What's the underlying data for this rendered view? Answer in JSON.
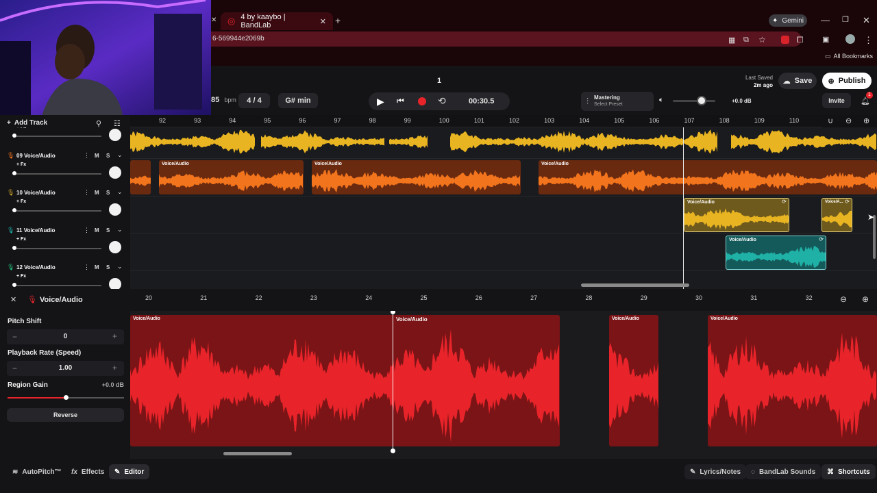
{
  "browser": {
    "tab_title": "4 by kaaybo | BandLab",
    "url_fragment": "6-569944e2069b",
    "gemini_label": "Gemini",
    "bookmarks_label": "All Bookmarks"
  },
  "project": {
    "title_number": "1",
    "last_saved_label": "Last Saved",
    "last_saved_value": "2m ago",
    "save_label": "Save",
    "publish_label": "Publish",
    "invite_label": "Invite",
    "notification_count": "1"
  },
  "transport": {
    "bpm_value": "85",
    "bpm_unit": "bpm",
    "time_signature": "4 / 4",
    "key": "G# min",
    "time": "00:30.5",
    "mastering_title": "Mastering",
    "mastering_preset": "Select Preset",
    "master_volume_db": "+0.0 dB"
  },
  "timeline": {
    "add_track_label": "Add Track",
    "ruler_ticks": [
      "92",
      "93",
      "94",
      "95",
      "96",
      "97",
      "98",
      "99",
      "100",
      "101",
      "102",
      "103",
      "104",
      "105",
      "106",
      "107",
      "108",
      "109",
      "110"
    ],
    "tracks": [
      {
        "number": "",
        "name": "",
        "fx": "+ Fx",
        "color": "#e8b422"
      },
      {
        "number": "09",
        "name": "Voice/Audio",
        "fx": "+ Fx",
        "color": "#f2741c"
      },
      {
        "number": "10",
        "name": "Voice/Audio",
        "fx": "+ Fx",
        "color": "#c8a22a"
      },
      {
        "number": "11",
        "name": "Voice/Audio",
        "fx": "+ Fx",
        "color": "#1fb0a6"
      },
      {
        "number": "12",
        "name": "Voice/Audio",
        "fx": "+ Fx",
        "color": "#22c07a"
      }
    ],
    "clip_label": "Voice/Audio",
    "clip_label_short": "Voice/A...",
    "mute_label": "M",
    "solo_label": "S"
  },
  "editor": {
    "title": "Voice/Audio",
    "ruler_ticks": [
      "20",
      "21",
      "22",
      "23",
      "24",
      "25",
      "26",
      "27",
      "28",
      "29",
      "30",
      "31",
      "32"
    ],
    "pitch_shift_label": "Pitch Shift",
    "pitch_shift_value": "0",
    "playback_rate_label": "Playback Rate (Speed)",
    "playback_rate_value": "1.00",
    "region_gain_label": "Region Gain",
    "region_gain_value": "+0.0 dB",
    "region_gain_level": 0.5,
    "reverse_label": "Reverse",
    "clip_label": "Voice/Audio",
    "minus": "−",
    "plus": "+"
  },
  "footer": {
    "autopitch_label": "AutoPitch™",
    "effects_label": "Effects",
    "editor_label": "Editor",
    "lyrics_label": "Lyrics/Notes",
    "sounds_label": "BandLab Sounds",
    "shortcuts_label": "Shortcuts"
  },
  "colors": {
    "accent_red": "#e8242a",
    "publish_bg": "#ffffff",
    "browser_bg": "#1a0508"
  }
}
